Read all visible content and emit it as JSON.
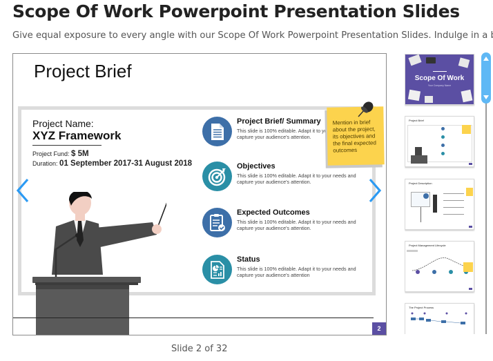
{
  "page": {
    "title": "Scope Of Work Powerpoint Presentation Slides",
    "description": "Give equal exposure to every angle with our Scope Of Work Powerpoint Presentation Slides. Indulge in a ba"
  },
  "slide": {
    "title": "Project Brief",
    "project_name_label": "Project Name:",
    "project_name_value": "XYZ Framework",
    "fund_label": "Project Fund:",
    "fund_value": "$ 5M",
    "duration_label": "Duration:",
    "duration_value": "01 September 2017-31 August 2018",
    "items": [
      {
        "title": "Project Brief/ Summary",
        "desc": "This slide is 100% editable. Adapt it to your needs and capture your audience's attention.",
        "icon": "document-icon",
        "color": "#3d6fa8"
      },
      {
        "title": "Objectives",
        "desc": "This slide is 100% editable. Adapt it to your needs and capture your audience's attention.",
        "icon": "target-icon",
        "color": "#2a8fa6"
      },
      {
        "title": "Expected Outcomes",
        "desc": "This slide is 100% editable. Adapt it to your needs and capture your audience's attention.",
        "icon": "clipboard-check-icon",
        "color": "#3d6fa8"
      },
      {
        "title": "Status",
        "desc": "This slide is 100% editable. Adapt it to your needs and capture your audience's attention",
        "icon": "report-chart-icon",
        "color": "#2a8fa6"
      }
    ],
    "sticky_note": "Mention in brief about the project, its objectives and the final expected outcomes",
    "page_number": "2"
  },
  "viewer": {
    "counter": "Slide 2 of 32",
    "prev_icon": "chevron-left-icon",
    "next_icon": "chevron-right-icon"
  },
  "thumbnails": [
    {
      "title": "Scope Of Work",
      "subtitle": "Your Company Name"
    },
    {
      "title": "Project Brief"
    },
    {
      "title": "Project Description"
    },
    {
      "title": "Project Management Lifecycle"
    },
    {
      "title": "The Project Process"
    }
  ],
  "colors": {
    "accent_blue": "#3d6fa8",
    "accent_teal": "#2a8fa6",
    "sticky_yellow": "#fcd34d",
    "badge_purple": "#5b4fa3",
    "nav_arrow": "#2b9af3",
    "scrollbar": "#5fb8f5"
  }
}
